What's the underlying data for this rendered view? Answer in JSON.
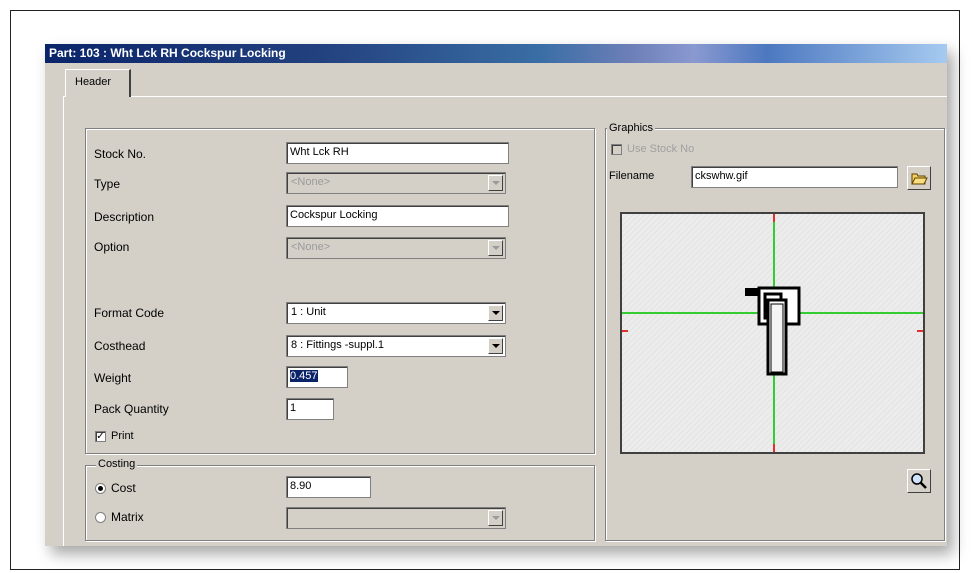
{
  "window": {
    "title": "Part: 103 : Wht Lck RH  Cockspur Locking",
    "tab_header": "Header"
  },
  "details": {
    "stock_no_label": "Stock No.",
    "stock_no_value": "Wht Lck RH",
    "type_label": "Type",
    "type_value": "<None>",
    "description_label": "Description",
    "description_value": "Cockspur Locking",
    "option_label": "Option",
    "option_value": "<None>",
    "format_code_label": "Format Code",
    "format_code_value": "1 : Unit",
    "costhead_label": "Costhead",
    "costhead_value": "8  : Fittings -suppl.1",
    "weight_label": "Weight",
    "weight_value": "0.457",
    "pack_quantity_label": "Pack Quantity",
    "pack_quantity_value": "1",
    "print_label": "Print",
    "print_checked": true
  },
  "costing": {
    "group_label": "Costing",
    "cost_label": "Cost",
    "cost_value": "8.90",
    "matrix_label": "Matrix",
    "selected": "cost"
  },
  "graphics": {
    "group_label": "Graphics",
    "use_stock_no_label": "Use Stock No",
    "filename_label": "Filename",
    "filename_value": "ckswhw.gif",
    "open_icon": "folder-open-icon",
    "zoom_icon": "magnifier-icon"
  },
  "colors": {
    "dialog_bg": "#d4d0c8",
    "crosshair": "#33cc33",
    "tick": "#e03030",
    "selection": "#0a246a"
  }
}
